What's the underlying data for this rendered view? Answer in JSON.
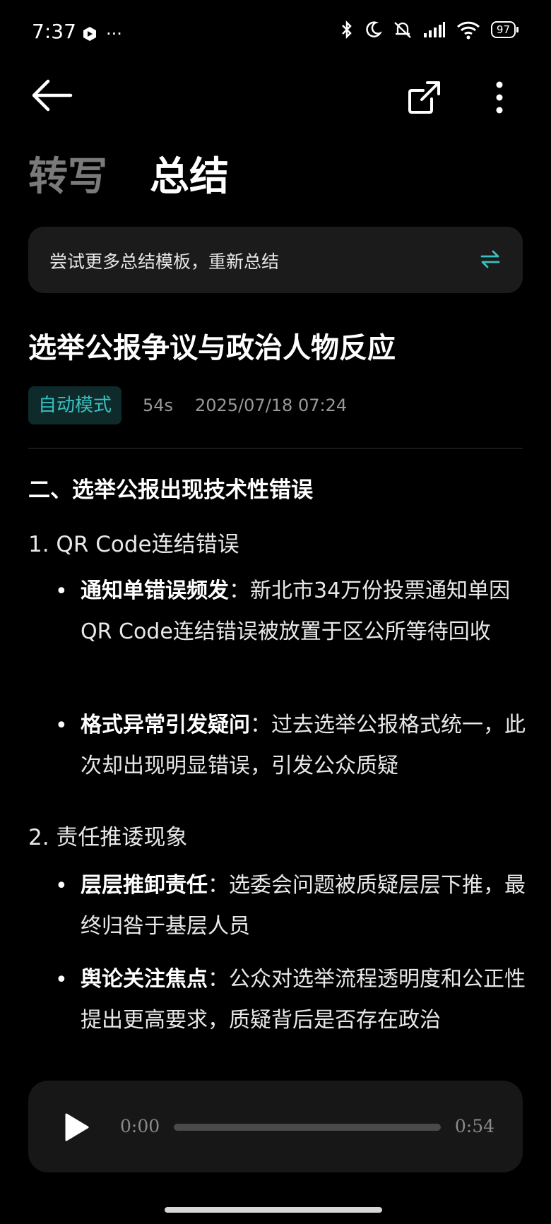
{
  "status_bar": {
    "time": "7:37",
    "dots": "···",
    "battery": "97"
  },
  "tabs": [
    {
      "label": "转写",
      "active": false
    },
    {
      "label": "总结",
      "active": true
    }
  ],
  "template_bar": {
    "text": "尝试更多总结模板，重新总结"
  },
  "document": {
    "title": "选举公报争议与政治人物反应",
    "mode_badge": "自动模式",
    "duration": "54s",
    "datetime": "2025/07/18 07:24",
    "section_heading": "二、选举公报出现技术性错误",
    "items": [
      {
        "label": "1. QR Code连结错误",
        "bullets": [
          {
            "bold": "通知单错误频发",
            "text": "：新北市34万份投票通知单因QR Code连结错误被放置于区公所等待回收"
          },
          {
            "bold": "格式异常引发疑问",
            "text": "：过去选举公报格式统一，此次却出现明显错误，引发公众质疑"
          }
        ]
      },
      {
        "label": "2. 责任推诿现象",
        "bullets": [
          {
            "bold": "层层推卸责任",
            "text": "：选委会问题被质疑层层下推，最终归咎于基层人员"
          },
          {
            "bold": "舆论关注焦点",
            "text": "：公众对选举流程透明度和公正性提出更高要求，质疑背后是否存在政治"
          }
        ]
      }
    ]
  },
  "player": {
    "current_time": "0:00",
    "total_time": "0:54",
    "progress": 0
  },
  "colors": {
    "accent": "#39c0c0",
    "background": "#000000",
    "card": "#1b1b1b"
  }
}
